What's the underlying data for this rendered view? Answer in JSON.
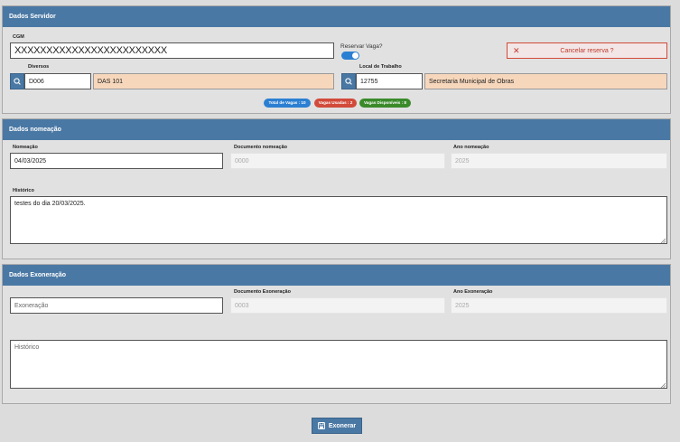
{
  "servidor": {
    "title": "Dados Servidor",
    "cgm_label": "CGM",
    "cgm_value": "XXXXXXXXXXXXXXXXXXXXXXXX",
    "reservar_label": "Reservar Vaga?",
    "reservar_on": true,
    "cancelar_label": "Cancelar reserva ?",
    "diversos_label": "Diversos",
    "diversos_code": "D006",
    "diversos_desc": "DAS 101",
    "local_label": "Local de Trabalho",
    "local_code": "12755",
    "local_desc": "Secretaria Municipal de Obras",
    "badge_total": "Total de Vagas : 10",
    "badge_usadas": "Vagas Usadas : 2",
    "badge_disponiveis": "Vagas Disponíveis : 8"
  },
  "nomeacao": {
    "title": "Dados nomeação",
    "nomeacao_label": "Nomeação",
    "nomeacao_value": "04/03/2025",
    "documento_label": "Documento nomeação",
    "documento_value": "0000",
    "ano_label": "Ano nomeação",
    "ano_value": "2025",
    "historico_label": "Histórico",
    "historico_value": "testes do dia 20/03/2025."
  },
  "exoneracao": {
    "title": "Dados Exoneração",
    "exoneracao_placeholder": "Exoneração",
    "documento_label": "Documento Exoneração",
    "documento_value": "0003",
    "ano_label": "Ano Exoneração",
    "ano_value": "2025",
    "historico_placeholder": "Histórico"
  },
  "footer": {
    "exonerar_label": "Exonerar"
  },
  "colors": {
    "header": "#4a78a4",
    "badge_total": "#2b7fd2",
    "badge_usadas": "#d24a3a",
    "badge_disponiveis": "#3a8a2a",
    "cancel": "#d24a3a",
    "readonly_fill": "#f7d7bc"
  },
  "icons": [
    "search-icon",
    "close-icon",
    "save-icon",
    "toggle-switch"
  ]
}
